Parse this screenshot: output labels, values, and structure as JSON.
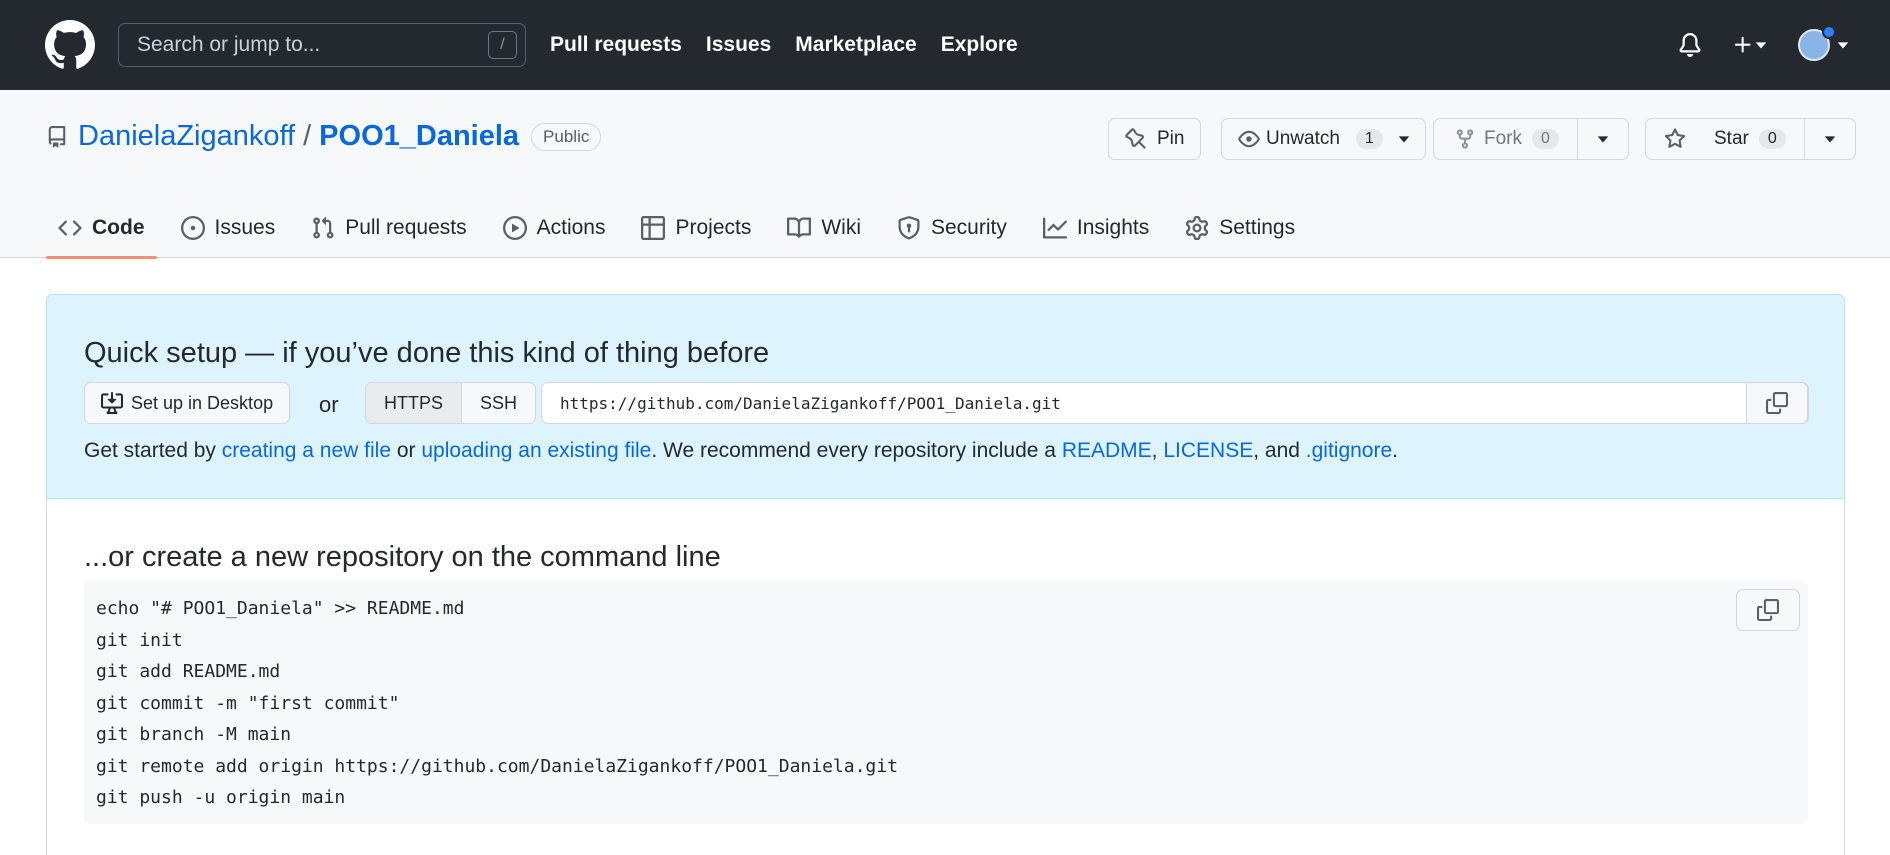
{
  "header": {
    "search_placeholder": "Search or jump to...",
    "search_shortcut": "/",
    "nav": [
      "Pull requests",
      "Issues",
      "Marketplace",
      "Explore"
    ]
  },
  "repo": {
    "owner": "DanielaZigankoff",
    "separator": "/",
    "name": "POO1_Daniela",
    "visibility": "Public",
    "pin_label": "Pin",
    "unwatch_label": "Unwatch",
    "watch_count": "1",
    "fork_label": "Fork",
    "fork_count": "0",
    "star_label": "Star",
    "star_count": "0"
  },
  "tabs": [
    {
      "label": "Code",
      "icon": "code-icon"
    },
    {
      "label": "Issues",
      "icon": "issue-icon"
    },
    {
      "label": "Pull requests",
      "icon": "pull-request-icon"
    },
    {
      "label": "Actions",
      "icon": "play-icon"
    },
    {
      "label": "Projects",
      "icon": "table-icon"
    },
    {
      "label": "Wiki",
      "icon": "book-icon"
    },
    {
      "label": "Security",
      "icon": "shield-icon"
    },
    {
      "label": "Insights",
      "icon": "graph-icon"
    },
    {
      "label": "Settings",
      "icon": "gear-icon"
    }
  ],
  "quick_setup": {
    "title": "Quick setup — if you’ve done this kind of thing before",
    "desktop_label": "Set up in Desktop",
    "or": "or",
    "protocols": [
      "HTTPS",
      "SSH"
    ],
    "url": "https://github.com/DanielaZigankoff/POO1_Daniela.git",
    "get_started": {
      "t1": "Get started by ",
      "l1": "creating a new file",
      "t2": " or ",
      "l2": "uploading an existing file",
      "t3": ". We recommend every repository include a ",
      "l3": "README",
      "t4": ", ",
      "l4": "LICENSE",
      "t5": ", and ",
      "l5": ".gitignore",
      "t6": "."
    }
  },
  "command_line": {
    "title": "...or create a new repository on the command line",
    "lines": [
      "echo \"# POO1_Daniela\" >> README.md",
      "git init",
      "git add README.md",
      "git commit -m \"first commit\"",
      "git branch -M main",
      "git remote add origin https://github.com/DanielaZigankoff/POO1_Daniela.git",
      "git push -u origin main"
    ]
  }
}
